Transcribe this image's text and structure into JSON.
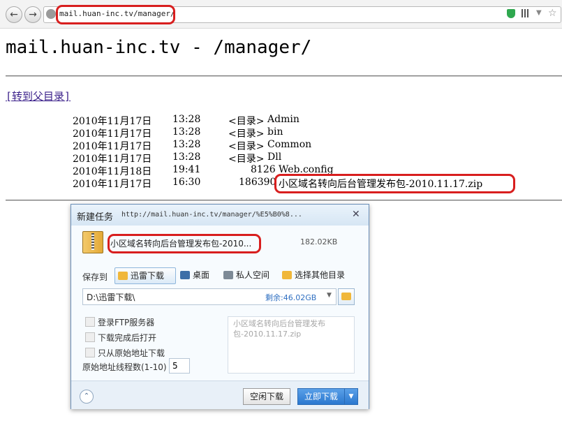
{
  "browser": {
    "back_icon": "back-arrow-icon",
    "forward_icon": "forward-arrow-icon",
    "address": "mail.huan-inc.tv/manager/",
    "highlight_color": "#d81e1e"
  },
  "page": {
    "title": "mail.huan-inc.tv - /manager/",
    "parent_link": "[转到父目录]",
    "entries": [
      {
        "date": "2010年11月17日",
        "time": "13:28",
        "size": "<目录>",
        "name": "Admin"
      },
      {
        "date": "2010年11月17日",
        "time": "13:28",
        "size": "<目录>",
        "name": "bin"
      },
      {
        "date": "2010年11月17日",
        "time": "13:28",
        "size": "<目录>",
        "name": "Common"
      },
      {
        "date": "2010年11月17日",
        "time": "13:28",
        "size": "<目录>",
        "name": "Dll"
      },
      {
        "date": "2010年11月18日",
        "time": "19:41",
        "size": "8126",
        "name": "Web.config"
      },
      {
        "date": "2010年11月17日",
        "time": "16:30",
        "size": "186390",
        "name": "小区域名转向后台管理发布包-2010.11.17.zip"
      }
    ]
  },
  "dialog": {
    "title": "新建任务",
    "url": "http://mail.huan-inc.tv/manager/%E5%B0%8...",
    "close": "✕",
    "filename": "小区域名转向后台管理发布包-2010...",
    "filesize": "182.02KB",
    "save_to_label": "保存到",
    "destinations": [
      "迅雷下载",
      "桌面",
      "私人空间",
      "选择其他目录"
    ],
    "path": "D:\\迅雷下载\\",
    "free_space": "剩余:46.02GB",
    "options": [
      "登录FTP服务器",
      "下载完成后打开",
      "只从原始地址下载"
    ],
    "thread_label": "原始地址线程数(1-10)",
    "thread_value": "5",
    "comment": "小区域名转向后台管理发布包-2010.11.17.zip",
    "idle_download": "空闲下载",
    "download_now": "立即下载"
  }
}
